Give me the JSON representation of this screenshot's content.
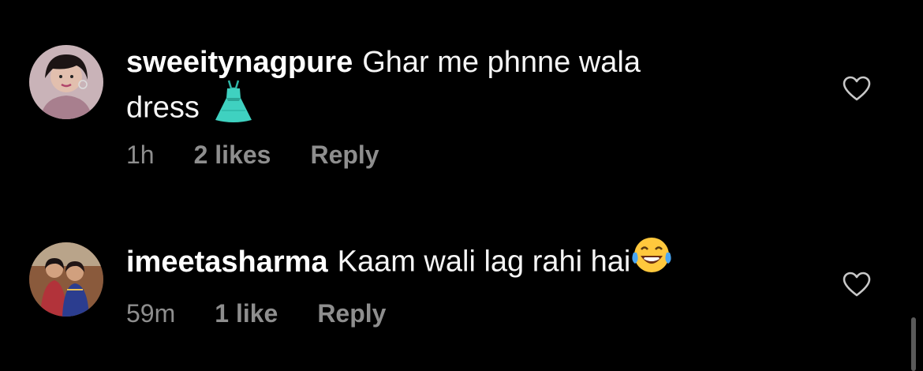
{
  "comments": [
    {
      "username": "sweeitynagpure",
      "text_line1": "Ghar me phnne wala",
      "text_line2": "dress",
      "emoji": "dress-emoji",
      "time": "1h",
      "likes": "2 likes",
      "reply": "Reply"
    },
    {
      "username": "imeetasharma",
      "text_line1": "Kaam wali lag rahi hai",
      "emoji": "tears-of-joy-emoji",
      "time": "59m",
      "likes": "1 like",
      "reply": "Reply"
    }
  ],
  "colors": {
    "background": "#000000",
    "text": "#ffffff",
    "meta": "#8e8e8e",
    "dress": "#3fd1c0"
  }
}
